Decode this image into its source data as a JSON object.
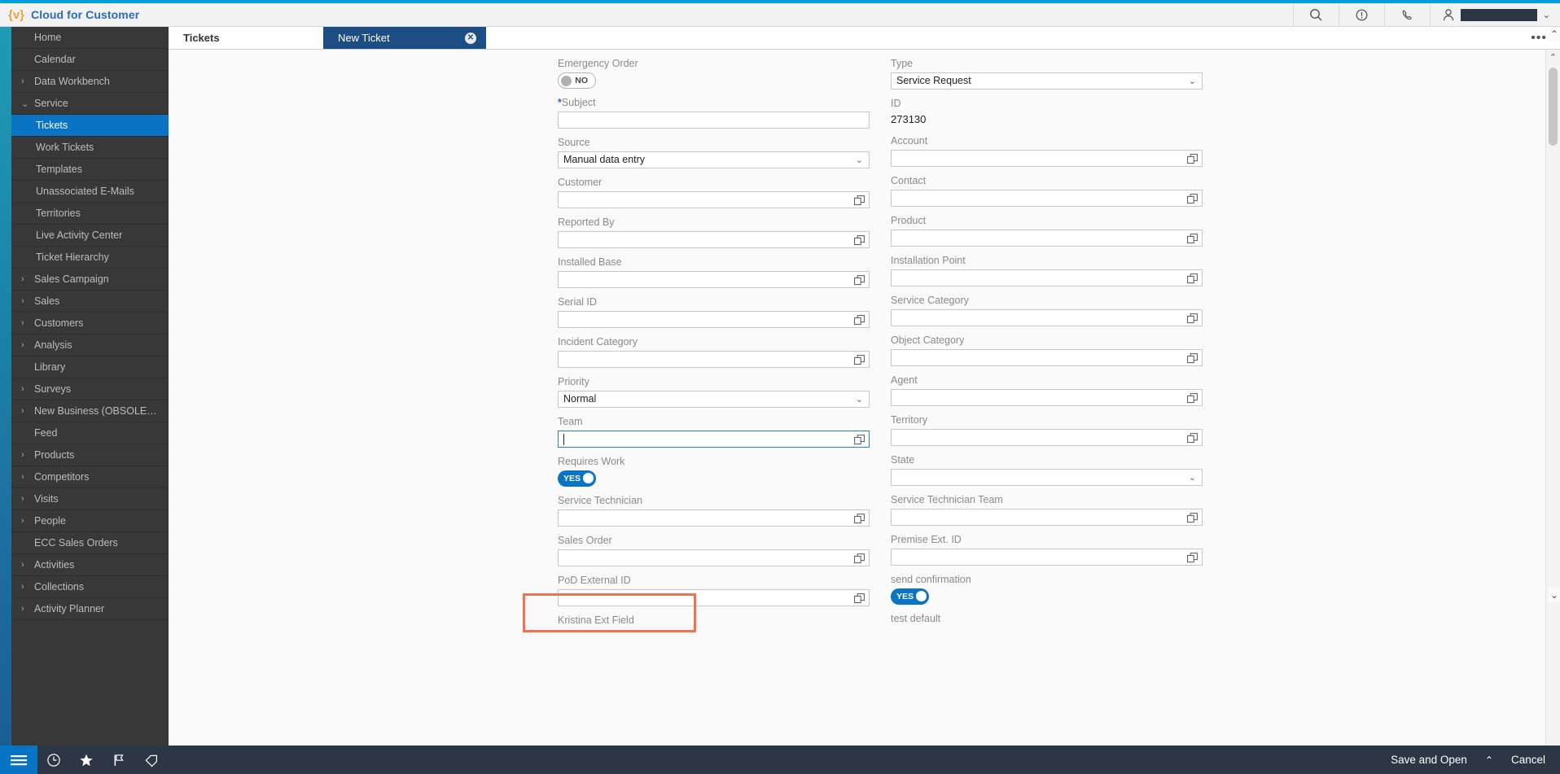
{
  "header": {
    "brand_logo": "{v}",
    "brand_title": "Cloud for Customer",
    "icons": {
      "search": "search-icon",
      "alert": "exclamation-circle-icon",
      "phone": "phone-icon",
      "user": "person-icon",
      "chevron": "chevron-down-icon"
    }
  },
  "tabs": [
    {
      "label": "Tickets",
      "active": false
    },
    {
      "label": "New Ticket",
      "active": true
    }
  ],
  "tab_overflow": "•••",
  "sidebar": {
    "items": [
      {
        "label": "Home",
        "expandable": false,
        "child": false,
        "active": false
      },
      {
        "label": "Calendar",
        "expandable": false,
        "child": false,
        "active": false
      },
      {
        "label": "Data Workbench",
        "expandable": true,
        "child": false,
        "active": false,
        "arrow": "›"
      },
      {
        "label": "Service",
        "expandable": true,
        "child": false,
        "active": false,
        "arrow": "⌄"
      },
      {
        "label": "Tickets",
        "expandable": false,
        "child": true,
        "active": true
      },
      {
        "label": "Work Tickets",
        "expandable": false,
        "child": true,
        "active": false
      },
      {
        "label": "Templates",
        "expandable": false,
        "child": true,
        "active": false
      },
      {
        "label": "Unassociated E-Mails",
        "expandable": false,
        "child": true,
        "active": false
      },
      {
        "label": "Territories",
        "expandable": false,
        "child": true,
        "active": false
      },
      {
        "label": "Live Activity Center",
        "expandable": false,
        "child": true,
        "active": false
      },
      {
        "label": "Ticket Hierarchy",
        "expandable": false,
        "child": true,
        "active": false
      },
      {
        "label": "Sales Campaign",
        "expandable": true,
        "child": false,
        "active": false,
        "arrow": "›"
      },
      {
        "label": "Sales",
        "expandable": true,
        "child": false,
        "active": false,
        "arrow": "›"
      },
      {
        "label": "Customers",
        "expandable": true,
        "child": false,
        "active": false,
        "arrow": "›"
      },
      {
        "label": "Analysis",
        "expandable": true,
        "child": false,
        "active": false,
        "arrow": "›"
      },
      {
        "label": "Library",
        "expandable": false,
        "child": false,
        "active": false
      },
      {
        "label": "Surveys",
        "expandable": true,
        "child": false,
        "active": false,
        "arrow": "›"
      },
      {
        "label": "New Business (OBSOLE…",
        "expandable": true,
        "child": false,
        "active": false,
        "arrow": "›"
      },
      {
        "label": "Feed",
        "expandable": false,
        "child": false,
        "active": false
      },
      {
        "label": "Products",
        "expandable": true,
        "child": false,
        "active": false,
        "arrow": "›"
      },
      {
        "label": "Competitors",
        "expandable": true,
        "child": false,
        "active": false,
        "arrow": "›"
      },
      {
        "label": "Visits",
        "expandable": true,
        "child": false,
        "active": false,
        "arrow": "›"
      },
      {
        "label": "People",
        "expandable": true,
        "child": false,
        "active": false,
        "arrow": "›"
      },
      {
        "label": "ECC Sales Orders",
        "expandable": false,
        "child": false,
        "active": false
      },
      {
        "label": "Activities",
        "expandable": true,
        "child": false,
        "active": false,
        "arrow": "›"
      },
      {
        "label": "Collections",
        "expandable": true,
        "child": false,
        "active": false,
        "arrow": "›"
      },
      {
        "label": "Activity Planner",
        "expandable": true,
        "child": false,
        "active": false,
        "arrow": "›"
      }
    ],
    "scroll_up": "⌃",
    "scroll_down": "⌄"
  },
  "taskbar": {
    "menu_icon": "hamburger-menu-icon",
    "icons": [
      "clock-icon",
      "star-icon",
      "flag-icon",
      "tag-icon"
    ]
  },
  "form": {
    "left": [
      {
        "label": "Emergency Order",
        "type": "toggle",
        "value": "NO",
        "state": "off"
      },
      {
        "label": "Subject",
        "type": "text",
        "value": "",
        "required": true
      },
      {
        "label": "Source",
        "type": "select",
        "value": "Manual data entry"
      },
      {
        "label": "Customer",
        "type": "lookup",
        "value": ""
      },
      {
        "label": "Reported By",
        "type": "lookup",
        "value": ""
      },
      {
        "label": "Installed Base",
        "type": "lookup",
        "value": ""
      },
      {
        "label": "Serial ID",
        "type": "lookup",
        "value": ""
      },
      {
        "label": "Incident Category",
        "type": "lookup",
        "value": ""
      },
      {
        "label": "Priority",
        "type": "select",
        "value": "Normal"
      },
      {
        "label": "Team",
        "type": "lookup",
        "value": "",
        "focused": true
      },
      {
        "label": "Requires Work",
        "type": "toggle",
        "value": "YES",
        "state": "on",
        "highlighted": true
      },
      {
        "label": "Service Technician",
        "type": "lookup",
        "value": ""
      },
      {
        "label": "Sales Order",
        "type": "lookup",
        "value": ""
      },
      {
        "label": "PoD External ID",
        "type": "lookup",
        "value": ""
      },
      {
        "label": "Kristina Ext Field",
        "type": "clipped",
        "value": ""
      }
    ],
    "right": [
      {
        "label": "Type",
        "type": "select",
        "value": "Service Request"
      },
      {
        "label": "ID",
        "type": "static",
        "value": "273130"
      },
      {
        "label": "Account",
        "type": "lookup",
        "value": ""
      },
      {
        "label": "Contact",
        "type": "lookup",
        "value": ""
      },
      {
        "label": "Product",
        "type": "lookup",
        "value": ""
      },
      {
        "label": "Installation Point",
        "type": "lookup",
        "value": ""
      },
      {
        "label": "Service Category",
        "type": "lookup",
        "value": ""
      },
      {
        "label": "Object Category",
        "type": "lookup",
        "value": ""
      },
      {
        "label": "Agent",
        "type": "lookup",
        "value": ""
      },
      {
        "label": "Territory",
        "type": "lookup",
        "value": ""
      },
      {
        "label": "State",
        "type": "select",
        "value": ""
      },
      {
        "label": "Service Technician Team",
        "type": "lookup",
        "value": ""
      },
      {
        "label": "Premise Ext. ID",
        "type": "lookup",
        "value": ""
      },
      {
        "label": "send confirmation",
        "type": "toggle",
        "value": "YES",
        "state": "on"
      },
      {
        "label": "test default",
        "type": "clipped",
        "value": ""
      }
    ]
  },
  "actionbar": {
    "save_label": "Save and Open",
    "chevron": "⌃",
    "cancel_label": "Cancel"
  },
  "colors": {
    "accent_blue": "#009ddc",
    "brand_blue": "#2b6cb8",
    "active_nav": "#0a74c4",
    "tab_active": "#1c4e85",
    "highlight": "#ef7350",
    "sidebar_bg": "#383838",
    "dark_bar": "#2d3644"
  }
}
